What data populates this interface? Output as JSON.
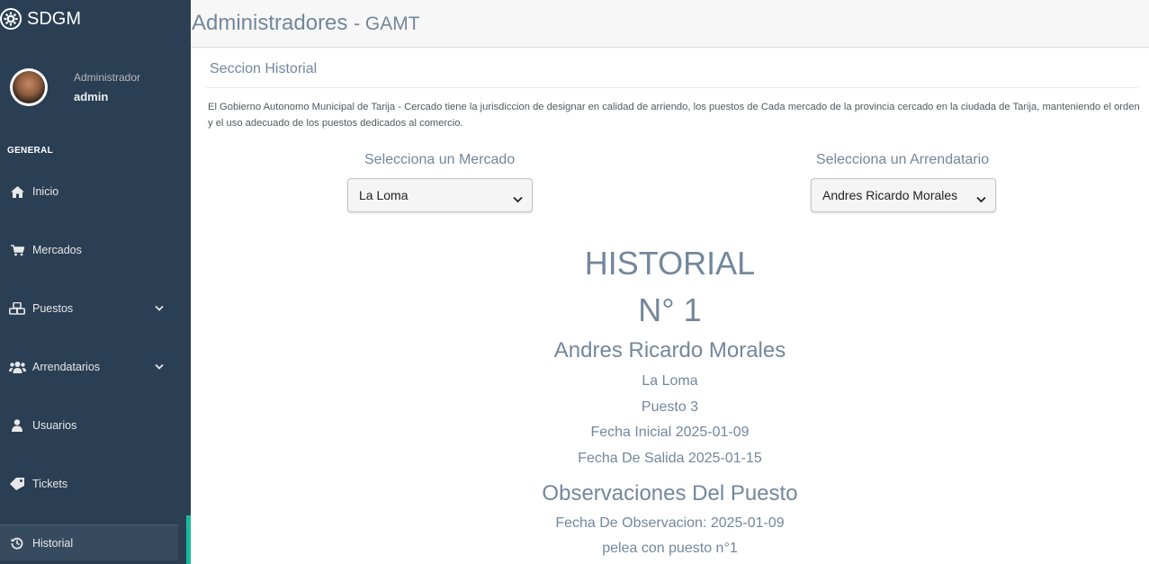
{
  "app": {
    "brand": "SDGM"
  },
  "profile": {
    "role": "Administrador",
    "username": "admin"
  },
  "sidebar": {
    "section": "GENERAL",
    "items": [
      {
        "label": "Inicio",
        "icon": "home-icon"
      },
      {
        "label": "Mercados",
        "icon": "cart-icon"
      },
      {
        "label": "Puestos",
        "icon": "cubes-icon",
        "has_submenu": true
      },
      {
        "label": "Arrendatarios",
        "icon": "users-icon",
        "has_submenu": true
      },
      {
        "label": "Usuarios",
        "icon": "user-icon"
      },
      {
        "label": "Tickets",
        "icon": "ticket-icon"
      },
      {
        "label": "Historial",
        "icon": "history-icon",
        "active": true
      }
    ]
  },
  "header": {
    "title": "Administradores",
    "subtitle": "- GAMT"
  },
  "panel": {
    "title": "Seccion Historial",
    "description": "El Gobierno Autonomo Municipal de Tarija - Cercado tiene la jurisdiccion de designar en calidad de arriendo, los puestos de Cada mercado de la provincia cercado en la ciudada de Tarija, manteniendo el orden y el uso adecuado de los puestos dedicados al comercio."
  },
  "filters": {
    "market_label": "Selecciona un Mercado",
    "market_value": "La Loma",
    "tenant_label": "Selecciona un Arrendatario",
    "tenant_value": "Andres Ricardo Morales"
  },
  "history": {
    "heading": "HISTORIAL",
    "number": "N° 1",
    "tenant": "Andres Ricardo Morales",
    "market": "La Loma",
    "stall": "Puesto 3",
    "start_date": "Fecha Inicial 2025-01-09",
    "end_date": "Fecha De Salida 2025-01-15",
    "observations_heading": "Observaciones Del Puesto",
    "observation_date": "Fecha De Observacion: 2025-01-09",
    "observation_text": "pelea con puesto n°1"
  },
  "colors": {
    "sidebar_bg": "#2a3f54",
    "accent": "#1abb9c",
    "text_muted": "#73879c"
  }
}
